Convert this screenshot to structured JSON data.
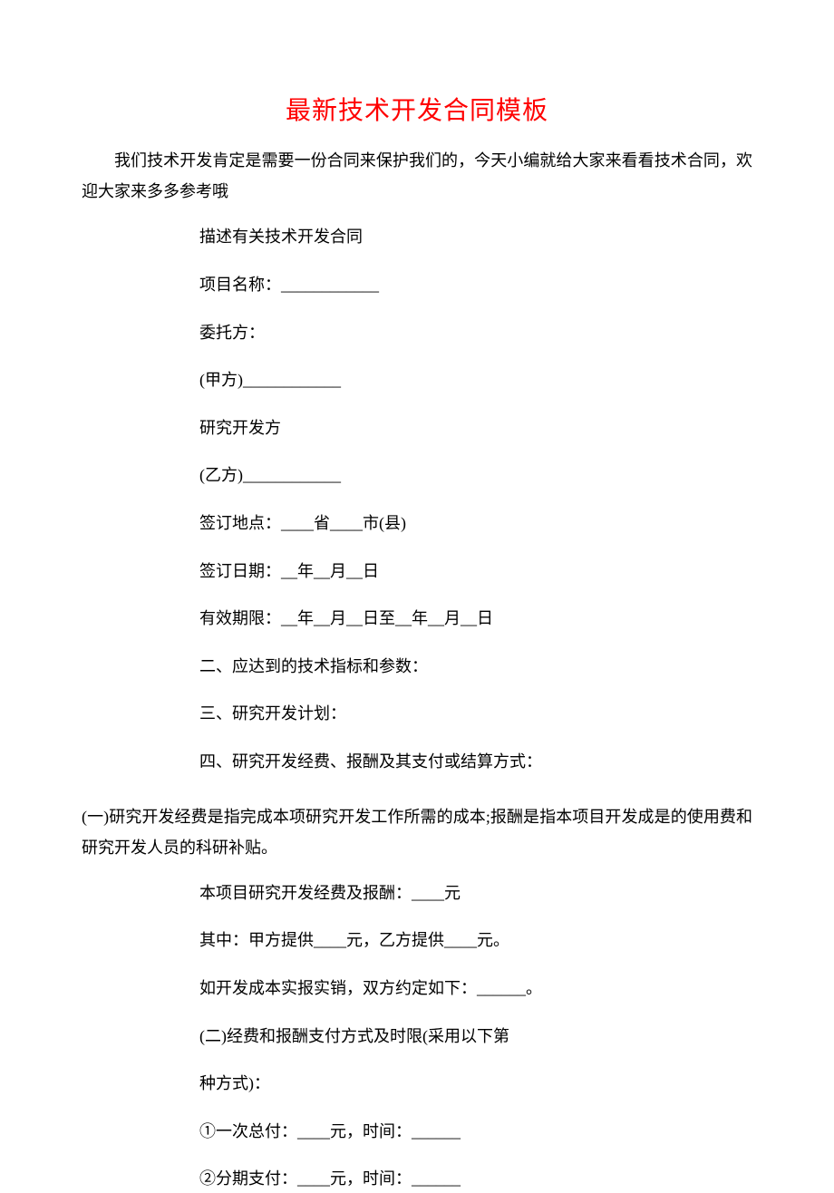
{
  "title": "最新技术开发合同模板",
  "intro": "我们技术开发肯定是需要一份合同来保护我们的，今天小编就给大家来看看技术合同，欢迎大家来多多参考哦",
  "section1": {
    "l1": "描述有关技术开发合同",
    "l2": "项目名称：____________",
    "l3": "委托方：",
    "l4": "(甲方)____________",
    "l5": "研究开发方",
    "l6": "(乙方)____________",
    "l7": "签订地点：____省____市(县)",
    "l8": "签订日期：__年__月__日",
    "l9": "有效期限：__年__月__日至__年__月__日",
    "l10": "二、应达到的技术指标和参数：",
    "l11": "三、研究开发计划：",
    "l12": "四、研究开发经费、报酬及其支付或结算方式："
  },
  "para1": "(一)研究开发经费是指完成本项研究开发工作所需的成本;报酬是指本项目开发成是的使用费和研究开发人员的科研补贴。",
  "section2": {
    "l1": "本项目研究开发经费及报酬：____元",
    "l2": "其中：甲方提供____元，乙方提供____元。",
    "l3": "如开发成本实报实销，双方约定如下：______。",
    "l4": "(二)经费和报酬支付方式及时限(采用以下第",
    "l5": "种方式)：",
    "l6": "①一次总付：____元，时间：______",
    "l7": "②分期支付：____元，时间：______"
  }
}
